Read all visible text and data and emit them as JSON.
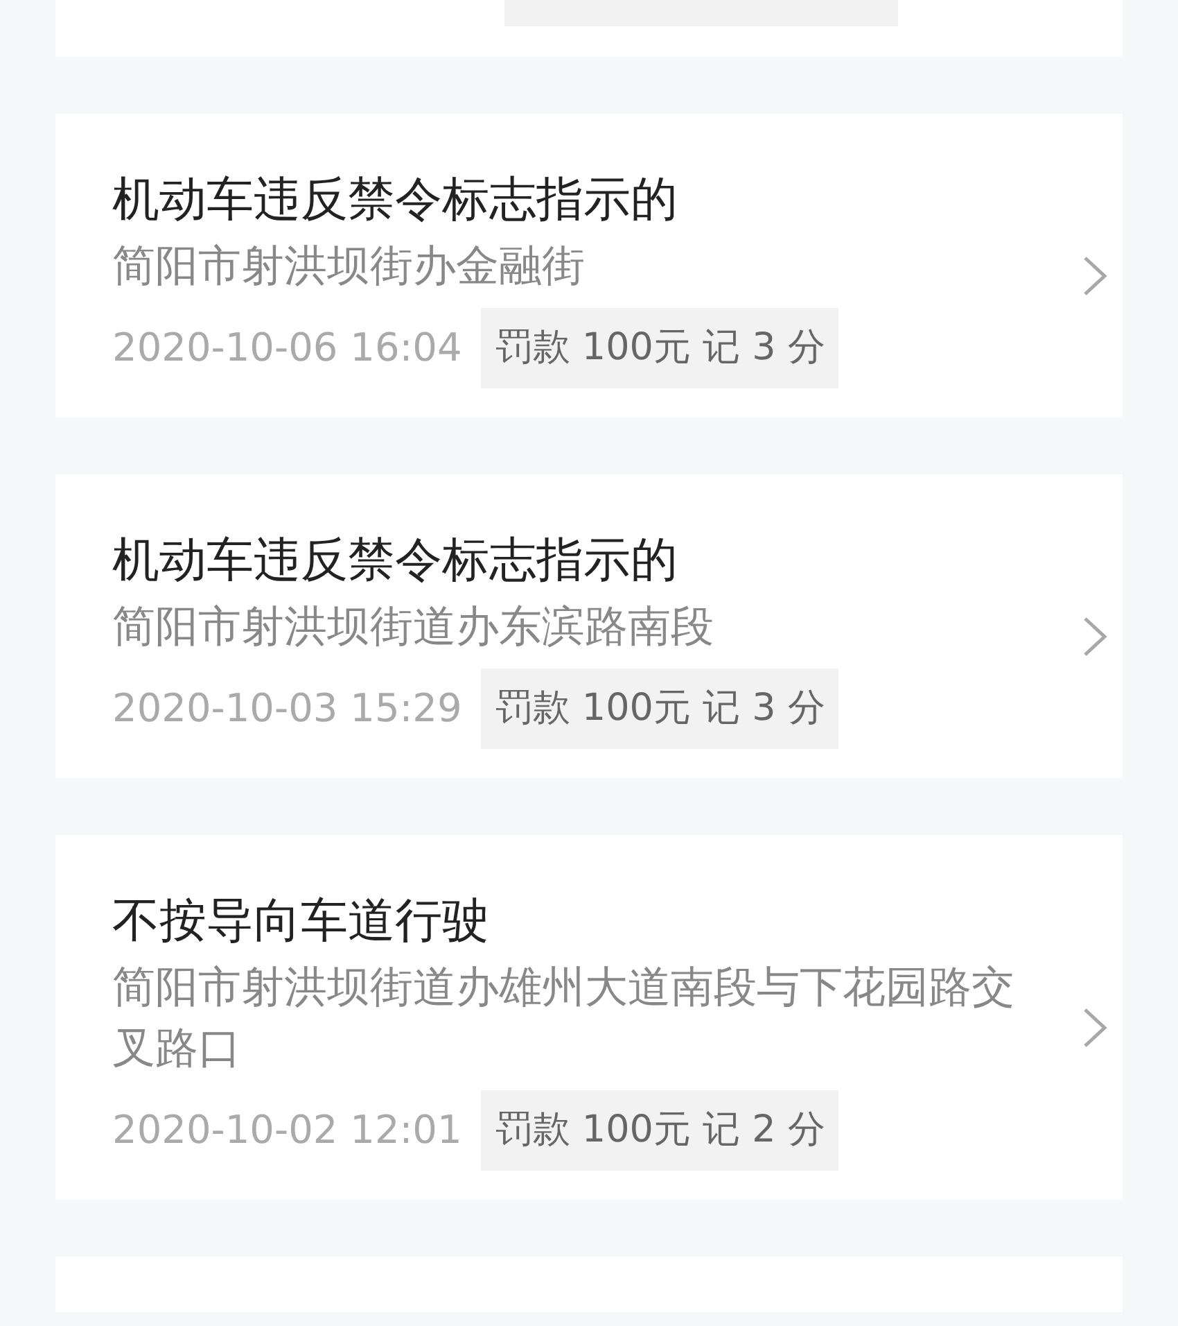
{
  "records": [
    {
      "title": "机动车违反禁令标志指示的",
      "location": "简阳市射洪坝街办金融街",
      "time": "2020-10-06 16:04",
      "penalty": "罚款 100元 记 3 分"
    },
    {
      "title": "机动车违反禁令标志指示的",
      "location": "简阳市射洪坝街道办东滨路南段",
      "time": "2020-10-03 15:29",
      "penalty": "罚款 100元 记 3 分"
    },
    {
      "title": "不按导向车道行驶",
      "location": "简阳市射洪坝街道办雄州大道南段与下花园路交叉路口",
      "time": "2020-10-02 12:01",
      "penalty": "罚款 100元 记 2 分"
    }
  ]
}
